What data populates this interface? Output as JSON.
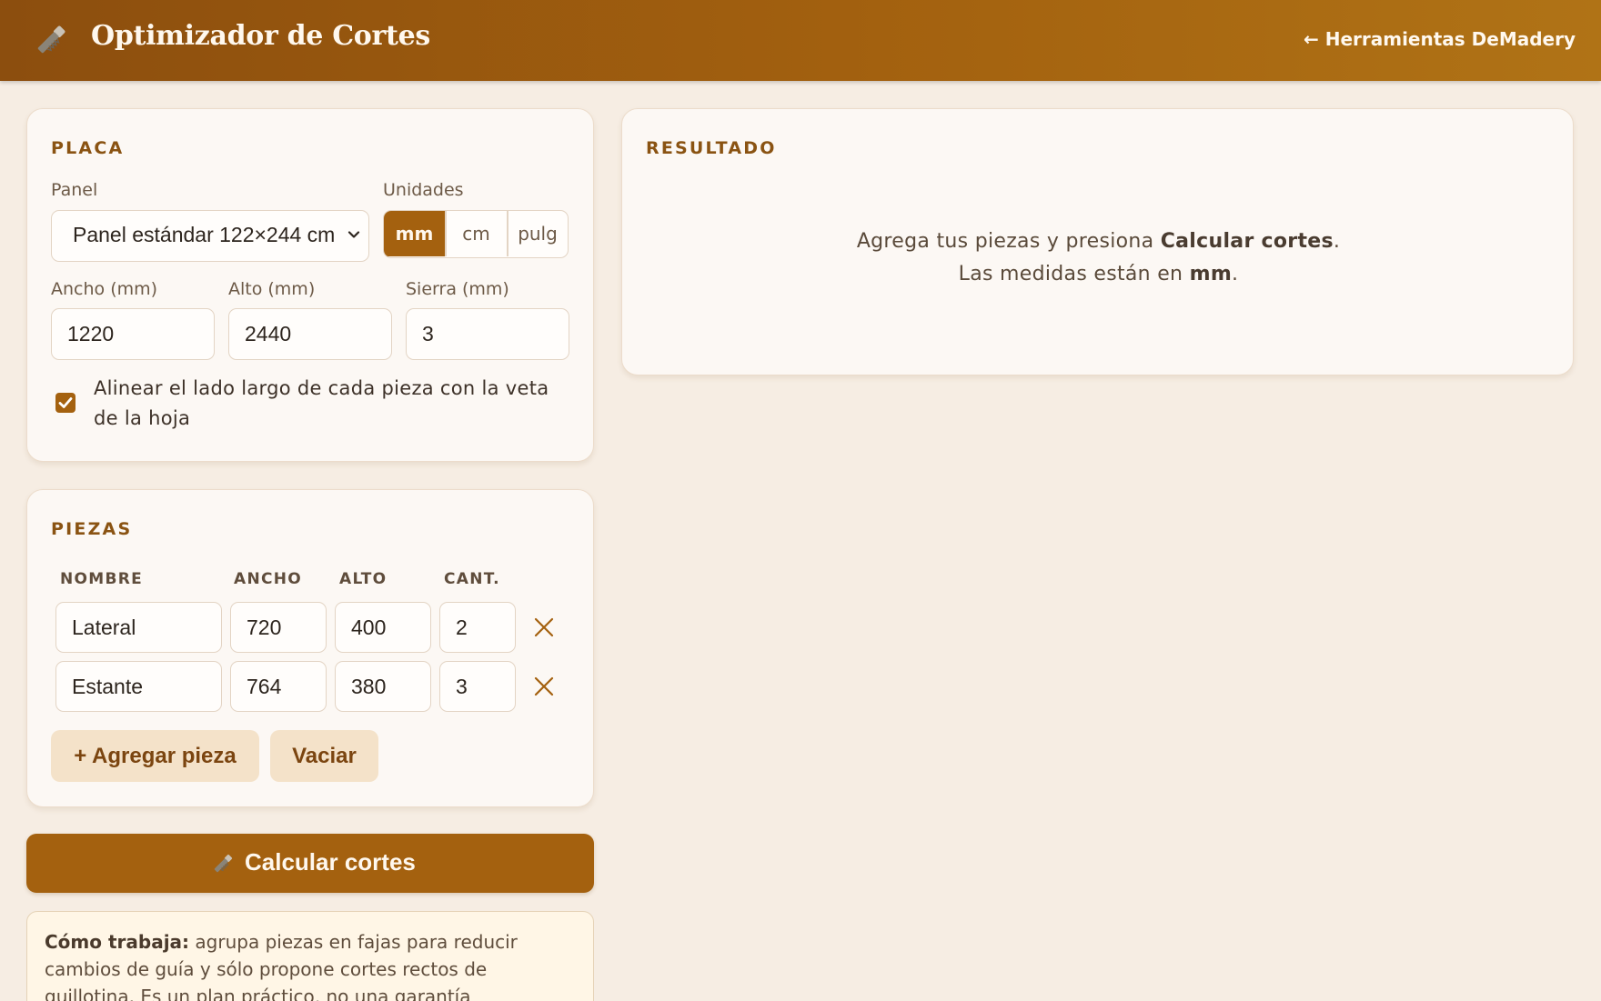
{
  "header": {
    "icon": "saw-icon",
    "title": "Optimizador de Cortes",
    "back_link": "← Herramientas DeMadery"
  },
  "colors": {
    "brand": "#a4610f",
    "header_gradient_start": "#8c4e0e",
    "header_gradient_end": "#b07316",
    "background": "#f6ede3",
    "soft_button": "#f4e2c9"
  },
  "placa": {
    "title": "PLACA",
    "panel_label": "Panel",
    "panel_value": "Panel estándar 122×244 cm",
    "units_label": "Unidades",
    "units": [
      "mm",
      "cm",
      "pulg"
    ],
    "units_selected": "mm",
    "ancho_label": "Ancho (mm)",
    "ancho_value": "1220",
    "alto_label": "Alto (mm)",
    "alto_value": "2440",
    "sierra_label": "Sierra (mm)",
    "sierra_value": "3",
    "grain_checked": true,
    "grain_label": "Alinear el lado largo de cada pieza con la veta de la hoja"
  },
  "piezas": {
    "title": "PIEZAS",
    "columns": [
      "NOMBRE",
      "ANCHO",
      "ALTO",
      "CANT."
    ],
    "rows": [
      {
        "nombre": "Lateral",
        "ancho": "720",
        "alto": "400",
        "cant": "2"
      },
      {
        "nombre": "Estante",
        "ancho": "764",
        "alto": "380",
        "cant": "3"
      }
    ],
    "add_button": "+ Agregar pieza",
    "clear_button": "Vaciar"
  },
  "calc_button": "Calcular cortes",
  "info": {
    "lead": "Cómo trabaja:",
    "text": " agrupa piezas en fajas para reducir cambios de guía y sólo propone cortes rectos de guillotina. Es un plan práctico, no una garantía"
  },
  "resultado": {
    "title": "RESULTADO",
    "msg_prefix": "Agrega tus piezas y presiona ",
    "msg_bold": "Calcular cortes",
    "msg_suffix": ".",
    "units_prefix": "Las medidas están en ",
    "units_bold": "mm",
    "units_suffix": "."
  }
}
